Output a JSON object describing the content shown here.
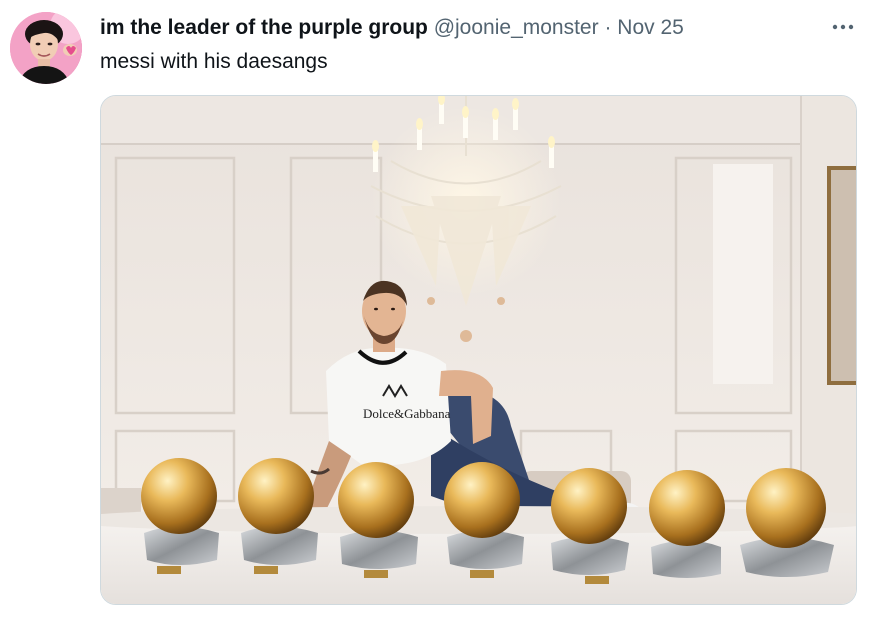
{
  "tweet": {
    "author_name": "im the leader of the purple group",
    "handle": "@joonie_monster",
    "separator": "·",
    "date": "Nov 25",
    "more_icon": "more-horizontal-icon",
    "text": "messi with his daesangs",
    "media": {
      "shirt_logo_text": "Dolce&Gabbana",
      "trophy_count": 7
    }
  }
}
